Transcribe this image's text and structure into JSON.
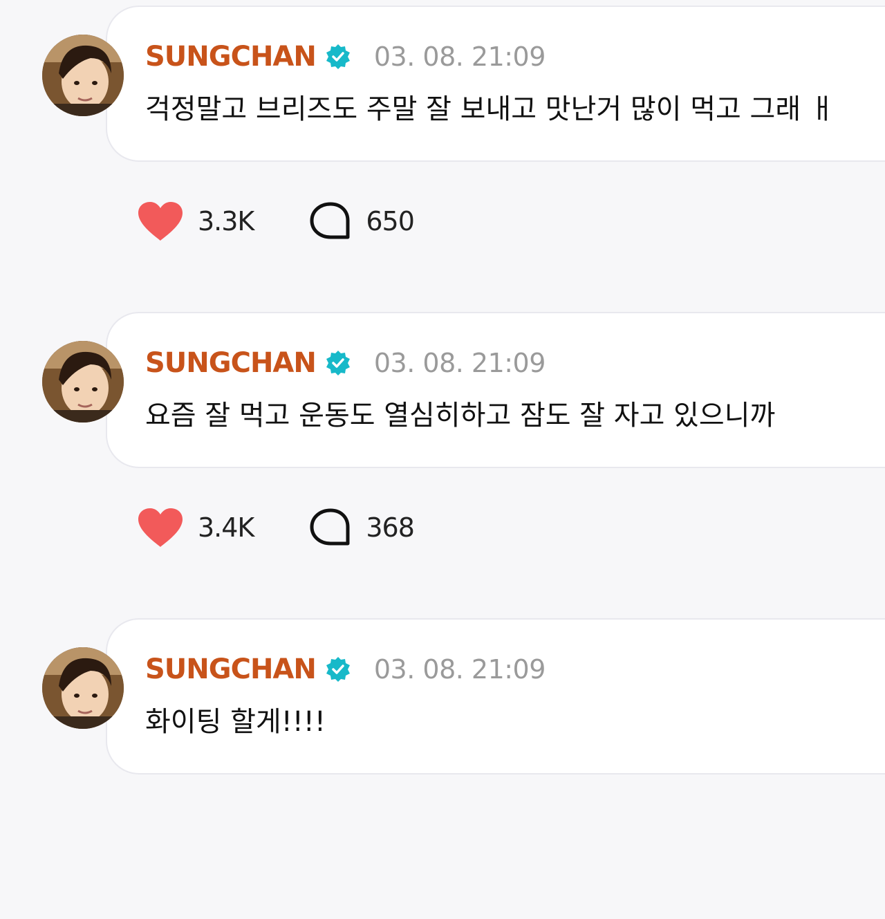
{
  "theme": {
    "username_color": "#c8531a",
    "verified_color": "#17b9c9",
    "like_color": "#f25a5a",
    "bubble_bg": "#ffffff",
    "page_bg": "#f7f7f9"
  },
  "icons": {
    "verified": "verified-badge-icon",
    "like": "heart-icon",
    "comment": "comment-bubble-icon"
  },
  "posts": [
    {
      "username": "SUNGCHAN",
      "timestamp": "03. 08. 21:09",
      "message": "걱정말고 브리즈도 주말 잘 보내고 맛난거 많이 먹고 그래 ㅐ",
      "likes": "3.3K",
      "comments": "650"
    },
    {
      "username": "SUNGCHAN",
      "timestamp": "03. 08. 21:09",
      "message": "요즘 잘 먹고 운동도 열심히하고 잠도 잘 자고 있으니까",
      "likes": "3.4K",
      "comments": "368"
    },
    {
      "username": "SUNGCHAN",
      "timestamp": "03. 08. 21:09",
      "message": "화이팅 할게!!!!",
      "likes": "",
      "comments": ""
    }
  ]
}
